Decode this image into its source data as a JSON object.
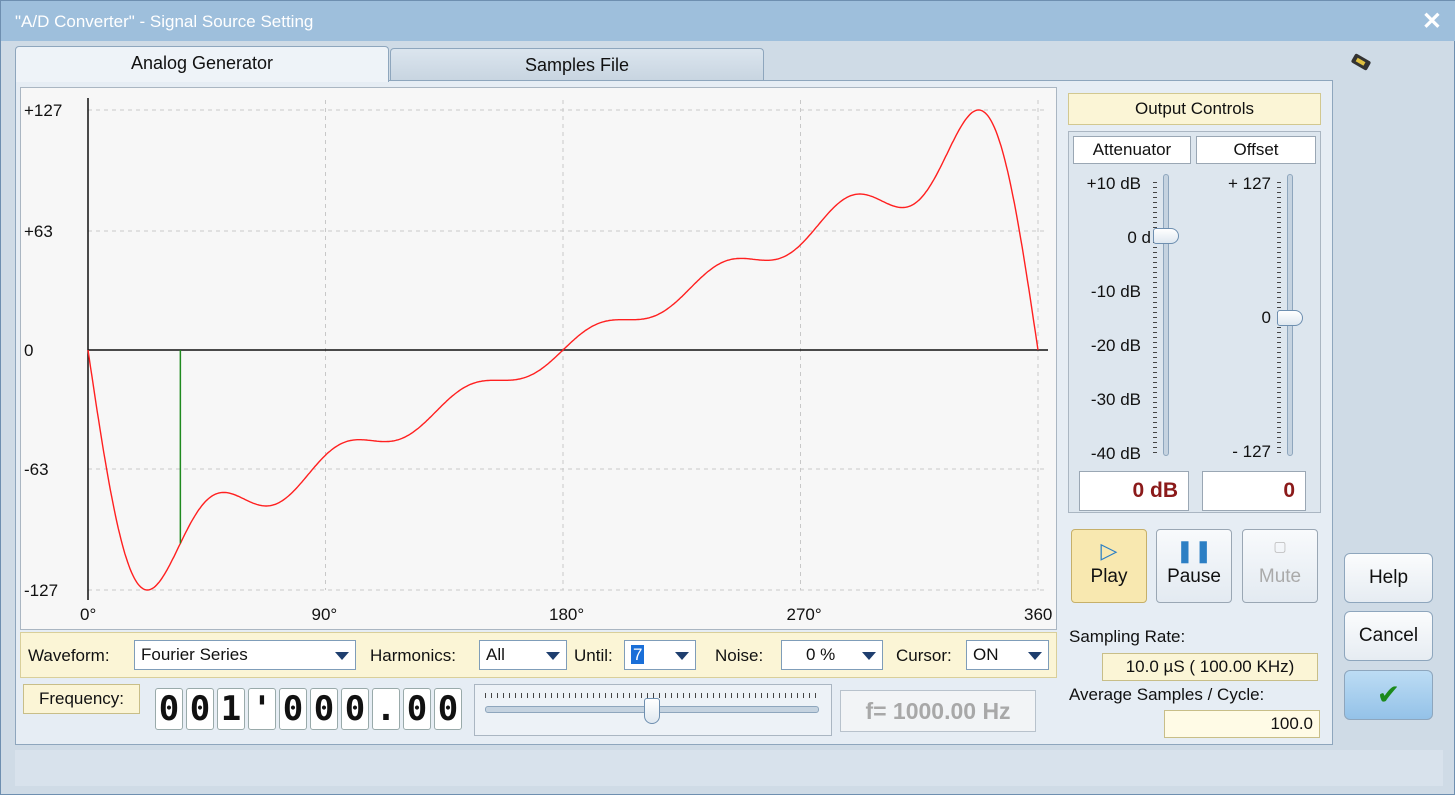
{
  "window": {
    "title": "\"A/D Converter\" -  Signal Source Setting",
    "close_glyph": "✕"
  },
  "tabs": [
    {
      "label": "Analog Generator",
      "active": true
    },
    {
      "label": "Samples File",
      "active": false
    }
  ],
  "plot": {
    "y_ticks": [
      "+127",
      "+63",
      "0",
      "-63",
      "-127"
    ],
    "x_ticks": [
      "0°",
      "90°",
      "180°",
      "270°",
      "360"
    ],
    "curve_color": "#ff2020",
    "cursor_color": "#1f8a1f",
    "cursor_position_deg": 35
  },
  "waveform_controls": {
    "waveform_label": "Waveform:",
    "waveform_value": "Fourier Series",
    "harmonics_label": "Harmonics:",
    "harmonics_value": "All",
    "until_label": "Until:",
    "until_value": "7",
    "noise_label": "Noise:",
    "noise_value": "0 %",
    "cursor_label": "Cursor:",
    "cursor_value": "ON"
  },
  "frequency": {
    "label": "Frequency:",
    "digits": [
      "0",
      "0",
      "1",
      "'",
      "0",
      "0",
      "0",
      ".",
      "0",
      "0"
    ],
    "slider_level": 0.5,
    "readout": "f= 1000.00 Hz"
  },
  "output_controls": {
    "title": "Output Controls",
    "attenuator": {
      "header": "Attenuator",
      "scale": [
        "+10 dB",
        "0 d",
        "-10 dB",
        "-20 dB",
        "-30 dB",
        "-40 dB"
      ],
      "level_db": 0,
      "readout": "0 dB"
    },
    "offset": {
      "header": "Offset",
      "scale": [
        "+ 127",
        "0",
        "- 127"
      ],
      "level": 0,
      "readout": "0"
    },
    "buttons": {
      "play": "Play",
      "pause": "Pause",
      "mute": "Mute"
    }
  },
  "sampling": {
    "rate_label": "Sampling Rate:",
    "rate_value": "10.0 µS ( 100.00 KHz)",
    "avg_label": "Average Samples / Cycle:",
    "avg_value": "100.0"
  },
  "side_buttons": {
    "help": "Help",
    "cancel": "Cancel",
    "ok": "✔"
  },
  "colors": {
    "accent": "#1a6fd8",
    "readout_red": "#8b1a1a",
    "note_yellow": "#fbf5d6"
  }
}
